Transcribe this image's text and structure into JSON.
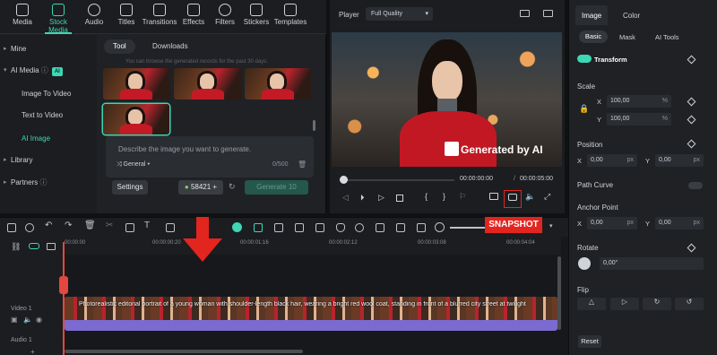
{
  "top_tabs": [
    {
      "label": "Media",
      "icon": "media-icon"
    },
    {
      "label": "Stock Media",
      "icon": "stock-media-icon"
    },
    {
      "label": "Audio",
      "icon": "music-icon"
    },
    {
      "label": "Titles",
      "icon": "titles-icon"
    },
    {
      "label": "Transitions",
      "icon": "transitions-icon"
    },
    {
      "label": "Effects",
      "icon": "effects-icon"
    },
    {
      "label": "Filters",
      "icon": "filters-icon"
    },
    {
      "label": "Stickers",
      "icon": "stickers-icon"
    },
    {
      "label": "Templates",
      "icon": "templates-icon"
    }
  ],
  "sidebar": {
    "items": [
      {
        "label": "Mine"
      },
      {
        "label": "AI Media",
        "badge": "AI"
      },
      {
        "label": "Image To Video"
      },
      {
        "label": "Text to Video"
      },
      {
        "label": "AI Image"
      },
      {
        "label": "Library"
      },
      {
        "label": "Partners"
      }
    ]
  },
  "subtabs": {
    "tool": "Tool",
    "downloads": "Downloads"
  },
  "hint": "You can browse the generated records for the past 30 days.",
  "prompt": {
    "placeholder": "Describe the image you want to generate.",
    "style": "General",
    "counter": "0/500"
  },
  "buttons": {
    "settings": "Settings",
    "credits": "58421",
    "generate": "Generate",
    "generate_cost": "10"
  },
  "player": {
    "label": "Player",
    "quality": "Full Quality",
    "current_time": "00:00:00:00",
    "separator": "/",
    "total_time": "00:00:05:00",
    "watermark": "Generated by AI"
  },
  "inspector": {
    "tabs": [
      "Image",
      "Color"
    ],
    "subtabs": [
      "Basic",
      "Mask",
      "AI Tools"
    ],
    "transform": "Transform",
    "scale": "Scale",
    "scale_x": "100,00",
    "scale_y": "100,00",
    "percent": "%",
    "position": "Position",
    "pos_x": "0,00",
    "pos_y": "0,00",
    "px": "px",
    "path_curve": "Path Curve",
    "anchor_point": "Anchor Point",
    "anchor_x": "0,00",
    "anchor_y": "0,00",
    "rotate": "Rotate",
    "rotate_val": "0,00°",
    "flip": "Flip",
    "reset": "Reset",
    "x": "X",
    "y": "Y"
  },
  "annotation": {
    "snapshot": "SNAPSHOT"
  },
  "timeline": {
    "ticks": [
      "00:00:00",
      "00:00:00:20",
      "00:00:01:16",
      "00:00:02:12",
      "00:00:03:08",
      "00:00:04:04"
    ],
    "video_track": "Video 1",
    "audio_track": "Audio 1",
    "clip_text": "Photorealistic editorial portrait of a young woman with shoulder-length black hair, wearing a bright red wool coat, standing in front of a blurred city street at twilight"
  }
}
